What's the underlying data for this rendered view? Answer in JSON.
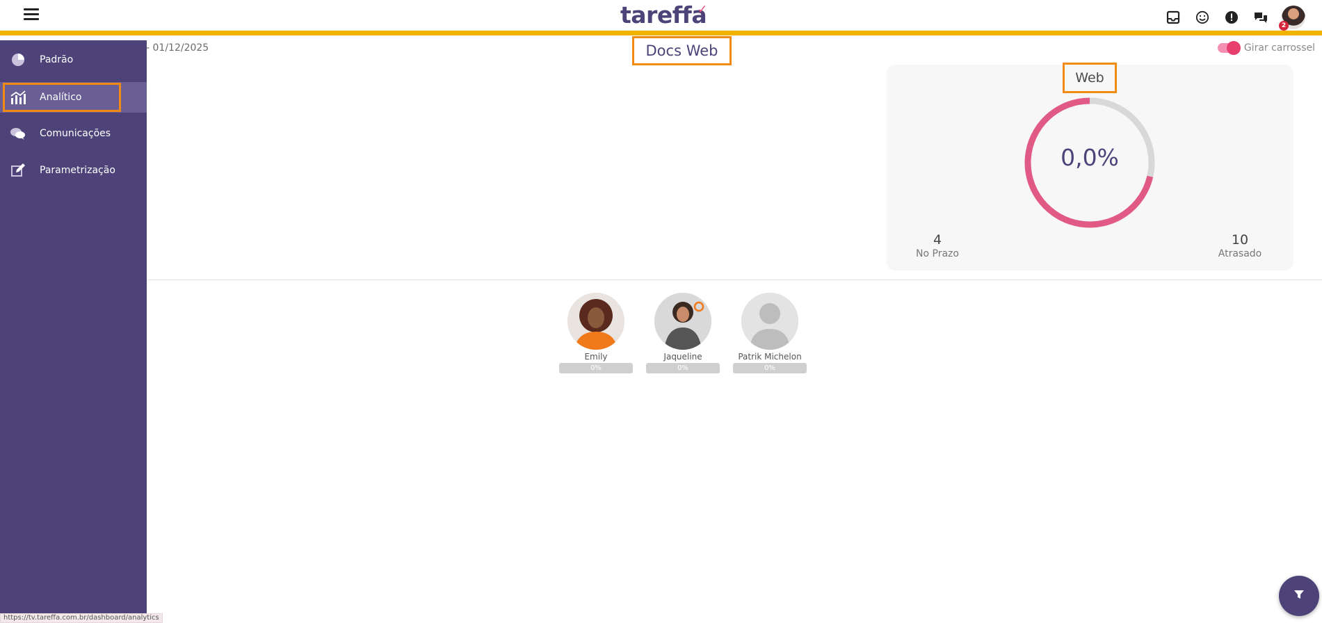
{
  "header": {
    "logo_text": "tareffa",
    "avatar_badge": "2",
    "brand_color": "#4e4379",
    "accent_color": "#e83e6d",
    "topbar_border_color": "#f0b400",
    "icons": [
      "menu-icon",
      "inbox-icon",
      "smile-icon",
      "alert-icon",
      "chat-icon"
    ]
  },
  "sidebar": {
    "items": [
      {
        "label": "Padrão",
        "icon": "pie-chart-icon"
      },
      {
        "label": "Analítico",
        "icon": "bar-chart-icon",
        "active": true
      },
      {
        "label": "Comunicações",
        "icon": "chat-bubbles-icon"
      },
      {
        "label": "Parametrização",
        "icon": "edit-icon"
      }
    ]
  },
  "main": {
    "date_range": "- 01/12/2025",
    "title": "Docs Web",
    "toggle_label": "Girar carrossel",
    "toggle_on": true
  },
  "card": {
    "title": "Web",
    "percent_label": "0,0%",
    "on_time": {
      "value": "4",
      "label": "No Prazo"
    },
    "late": {
      "value": "10",
      "label": "Atrasado"
    }
  },
  "chart_data": {
    "type": "pie",
    "categories": [
      "No Prazo",
      "Atrasado"
    ],
    "values": [
      4,
      10
    ],
    "colors": [
      "#d8d8d8",
      "#e05a85"
    ],
    "center_label": "0,0%"
  },
  "people": [
    {
      "name": "Emily",
      "progress_label": "0%",
      "progress": 0
    },
    {
      "name": "Jaqueline",
      "progress_label": "0%",
      "progress": 0
    },
    {
      "name": "Patrik Michelon",
      "progress_label": "0%",
      "progress": 0
    }
  ],
  "status_bar": {
    "url": "https://tv.tareffa.com.br/dashboard/analytics"
  }
}
